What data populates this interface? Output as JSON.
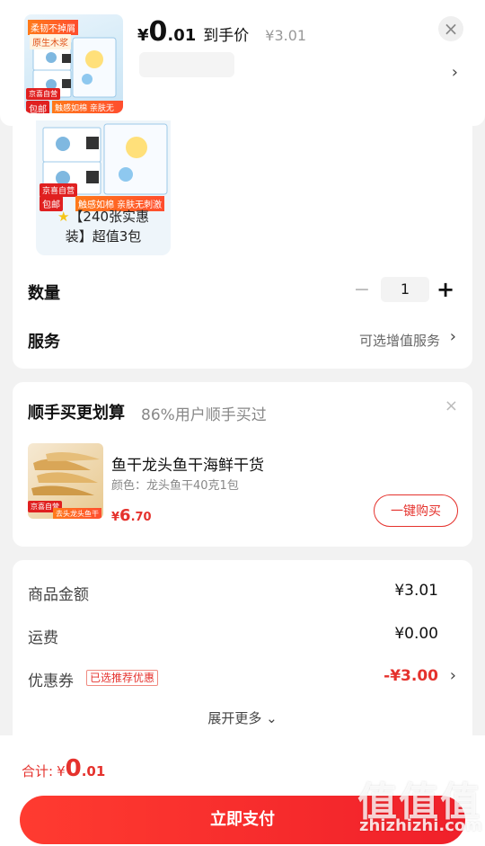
{
  "header": {
    "price_symbol": "¥",
    "price_int": "0",
    "price_dec": ".01",
    "price_tag": "到手价",
    "orig_price": "¥3.01",
    "close": "×",
    "chevron": "›",
    "thumb_badge_top": "柔韧不掉屑",
    "thumb_badge_top2": "原生木浆",
    "thumb_badge_left": "京喜自营",
    "thumb_badge_left2": "包邮",
    "thumb_badge_bottom": "触感如棉 亲肤无刺激"
  },
  "sku": {
    "label_line1": "【240张实惠",
    "label_line2": "装】超值3包",
    "star": "★",
    "badge_left": "京喜自营",
    "badge_left2": "包邮",
    "badge_bottom": "触感如棉 亲肤无刺激",
    "quantity_label": "数量",
    "quantity_minus": "−",
    "quantity_value": "1",
    "quantity_plus": "+",
    "service_label": "服务",
    "service_hint": "可选增值服务",
    "chevron": "›"
  },
  "addon": {
    "title": "顺手买更划算",
    "subtitle": "86%用户顺手买过",
    "close": "×",
    "product_name": "鱼干龙头鱼干海鲜干货",
    "product_spec": "颜色：龙头鱼干40克1包",
    "price_symbol": "¥",
    "price_int": "6",
    "price_dec": ".70",
    "buy_label": "一键购买",
    "img_badge": "京喜自营",
    "img_caption": "去头龙头鱼干"
  },
  "summary": {
    "goods_label": "商品金额",
    "goods_value": "¥3.01",
    "shipping_label": "运费",
    "shipping_value": "¥0.00",
    "coupon_label": "优惠券",
    "coupon_tag": "已选推荐优惠",
    "coupon_value": "-¥3.00",
    "chevron": "›",
    "expand_label": "展开更多 ⌄"
  },
  "footer": {
    "total_label": "合计:",
    "total_symbol": "¥",
    "total_int": "0",
    "total_dec": ".01",
    "pay_label": "立即支付"
  },
  "watermark": {
    "text": "值值值",
    "url": "zhizhizhi.com"
  },
  "colors": {
    "accent": "#e5322d",
    "background": "#f2f2f2"
  }
}
